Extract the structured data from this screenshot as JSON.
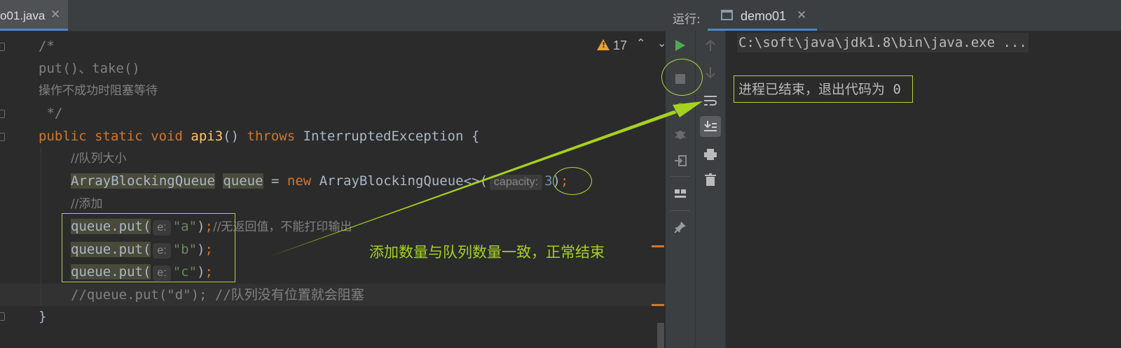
{
  "editor": {
    "file_tab": {
      "label": "o01.java",
      "close": "✕"
    },
    "inspection": {
      "warning_count": "17",
      "up": "⌃",
      "down": "⌄"
    },
    "code": {
      "l1": "/*",
      "l2": "put()、take()",
      "l3": "操作不成功时阻塞等待",
      "l4": " */",
      "l5": {
        "public": "public",
        "static": "static",
        "void": "void",
        "name": "api3",
        "paren": "()",
        "throws": "throws",
        "exception": "InterruptedException",
        "brace": "{"
      },
      "l6": "//队列大小",
      "l7": {
        "type": "ArrayBlockingQueue",
        "var": "queue",
        "eq": "=",
        "new": "new",
        "ctor": "ArrayBlockingQueue<>(",
        "hint": "capacity:",
        "arg": "3",
        "close": ")",
        "semi": ";"
      },
      "l8": "//添加",
      "l9": {
        "call": "queue.put(",
        "hint": "e:",
        "arg": "\"a\"",
        "close": ")",
        "semi": ";",
        "comment": "//无返回值，不能打印输出"
      },
      "l10": {
        "call": "queue.put(",
        "hint": "e:",
        "arg": "\"b\"",
        "close": ")",
        "semi": ";"
      },
      "l11": {
        "call": "queue.put(",
        "hint": "e:",
        "arg": "\"c\"",
        "close": ")",
        "semi": ";"
      },
      "l12": "//queue.put(\"d\"); //队列没有位置就会阻塞",
      "l13": "}"
    },
    "annotation": "添加数量与队列数量一致，正常结束"
  },
  "run": {
    "label": "运行:",
    "tab": {
      "label": "demo01",
      "close": "✕"
    },
    "console": {
      "line1": "C:\\soft\\java\\jdk1.8\\bin\\java.exe ...",
      "line2": "进程已结束，退出代码为 0"
    },
    "toolbar_icons": [
      "play-icon",
      "stop-icon",
      "camera-icon",
      "bug-icon",
      "login-icon",
      "layout-icon",
      "pin-icon",
      "arrow-up-icon",
      "arrow-down-icon",
      "soft-wrap-icon",
      "scroll-to-end-icon",
      "print-icon",
      "trash-icon"
    ]
  },
  "colors": {
    "annotation": "#a6d11e",
    "keyword": "#cc7832",
    "string": "#6a8759",
    "warning": "#e5a233"
  }
}
